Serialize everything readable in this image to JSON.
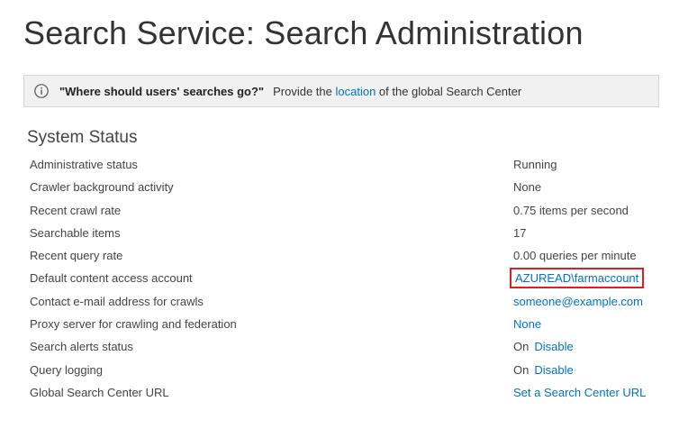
{
  "page": {
    "title": "Search Service: Search Administration"
  },
  "banner": {
    "question": "\"Where should users' searches go?\"",
    "text_before": "Provide the",
    "link_text": "location",
    "text_after": "of the global Search Center",
    "icon": "info-icon"
  },
  "system_status": {
    "title": "System Status",
    "rows": [
      {
        "label": "Administrative status",
        "value": "Running"
      },
      {
        "label": "Crawler background activity",
        "value": "None"
      },
      {
        "label": "Recent crawl rate",
        "value": "0.75 items per second"
      },
      {
        "label": "Searchable items",
        "value": "17"
      },
      {
        "label": "Recent query rate",
        "value": "0.00 queries per minute"
      },
      {
        "label": "Default content access account",
        "link": "AZUREAD\\farmaccount"
      },
      {
        "label": "Contact e-mail address for crawls",
        "link": "someone@example.com"
      },
      {
        "label": "Proxy server for crawling and federation",
        "link": "None"
      },
      {
        "label": "Search alerts status",
        "value": "On",
        "link": "Disable"
      },
      {
        "label": "Query logging",
        "value": "On",
        "link": "Disable"
      },
      {
        "label": "Global Search Center URL",
        "link": "Set a Search Center URL"
      }
    ]
  },
  "colors": {
    "link": "#0072c6",
    "highlight": "#e02020",
    "banner_bg": "#f1f1f1"
  }
}
